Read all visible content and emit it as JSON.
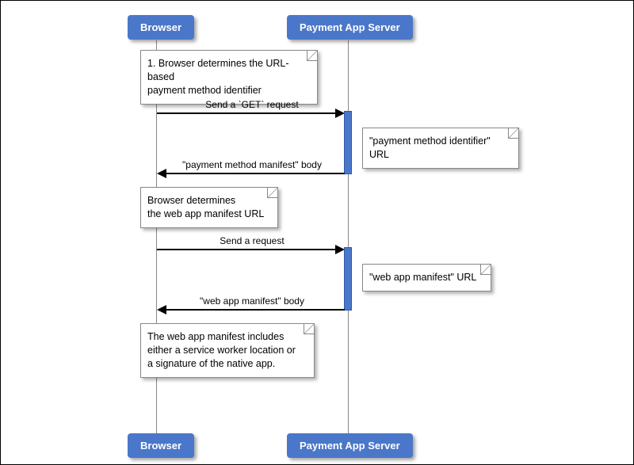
{
  "chart_data": {
    "type": "sequence-diagram",
    "participants": [
      "Browser",
      "Payment App Server"
    ],
    "steps": [
      {
        "kind": "note",
        "at": "Browser",
        "text": "1. Browser determines the URL-based payment method identifier"
      },
      {
        "kind": "message",
        "from": "Browser",
        "to": "Payment App Server",
        "label": "Send a `GET` request"
      },
      {
        "kind": "note",
        "at": "Payment App Server",
        "text": "\"payment method identifier\" URL"
      },
      {
        "kind": "message",
        "from": "Payment App Server",
        "to": "Browser",
        "label": "\"payment method manifest\" body"
      },
      {
        "kind": "note",
        "at": "Browser",
        "text": "Browser determines the web app manifest URL"
      },
      {
        "kind": "message",
        "from": "Browser",
        "to": "Payment App Server",
        "label": "Send a request"
      },
      {
        "kind": "note",
        "at": "Payment App Server",
        "text": "\"web app manifest\" URL"
      },
      {
        "kind": "message",
        "from": "Payment App Server",
        "to": "Browser",
        "label": "\"web app manifest\" body"
      },
      {
        "kind": "note",
        "at": "Browser",
        "text": "The web app manifest includes either a service worker location or a signature of the native app."
      }
    ]
  },
  "participants": {
    "browser": "Browser",
    "server": "Payment App Server"
  },
  "notes": {
    "n1a": "1. Browser determines the URL-based",
    "n1b": "payment method identifier",
    "n2": "\"payment method identifier\" URL",
    "n3a": "Browser determines",
    "n3b": "the web app manifest URL",
    "n4": "\"web app manifest\" URL",
    "n5a": "The web app manifest includes",
    "n5b": "either a service worker location or",
    "n5c": "a signature of the native app."
  },
  "messages": {
    "m1": "Send a `GET` request",
    "m2": "\"payment method manifest\" body",
    "m3": "Send a request",
    "m4": "\"web app manifest\" body"
  }
}
